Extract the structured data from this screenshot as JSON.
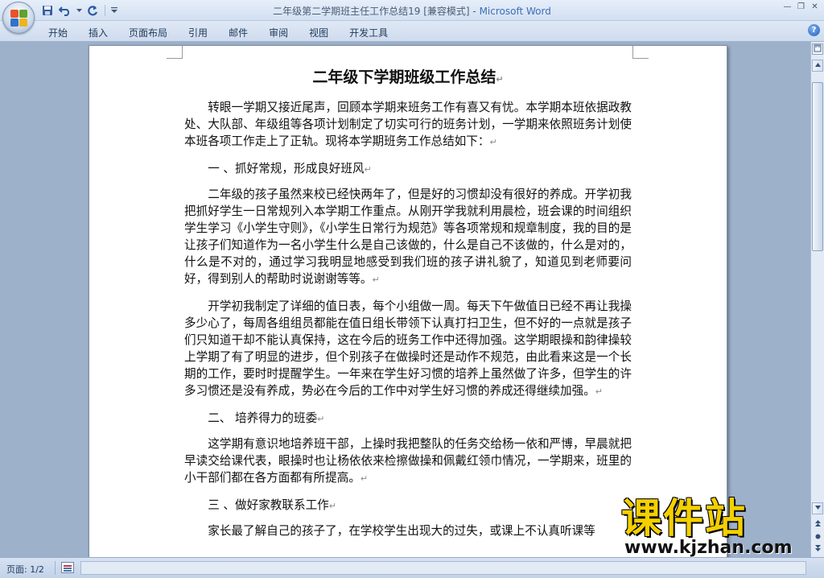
{
  "window": {
    "title": "二年级第二学期班主任工作总结19 [兼容模式]",
    "title_separator": " - ",
    "app_name": "Microsoft Word",
    "minimize": "—",
    "restore": "❐",
    "close": "✕"
  },
  "quick_access": {
    "save_icon": "save-icon",
    "undo_icon": "undo-icon",
    "redo_icon": "redo-icon",
    "customize_icon": "chevron-down-icon"
  },
  "ribbon": {
    "tabs": [
      "开始",
      "插入",
      "页面布局",
      "引用",
      "邮件",
      "审阅",
      "视图",
      "开发工具"
    ],
    "help": "?"
  },
  "document": {
    "title": "二年级下学期班级工作总结",
    "paragraphs": [
      "转眼一学期又接近尾声，回顾本学期来班务工作有喜又有忧。本学期本班依据政教处、大队部、年级组等各项计划制定了切实可行的班务计划，一学期来依照班务计划使本班各项工作走上了正轨。现将本学期班务工作总结如下：",
      "一 、抓好常规，形成良好班风",
      "二年级的孩子虽然来校已经快两年了，但是好的习惯却没有很好的养成。开学初我把抓好学生一日常规列入本学期工作重点。从刚开学我就利用晨检，班会课的时间组织学生学习《小学生守则》，《小学生日常行为规范》等各项常规和规章制度，我的目的是让孩子们知道作为一名小学生什么是自己该做的，什么是自己不该做的，什么是对的，什么是不对的，通过学习我明显地感受到我们班的孩子讲礼貌了，知道见到老师要问好，得到别人的帮助时说谢谢等等。",
      "开学初我制定了详细的值日表，每个小组做一周。每天下午做值日已经不再让我操多少心了，每周各组组员都能在值日组长带领下认真打扫卫生，但不好的一点就是孩子们只知道干却不能认真保持，这在今后的班务工作中还得加强。这学期眼操和韵律操较上学期了有了明显的进步，但个别孩子在做操时还是动作不规范，由此看来这是一个长期的工作，要时时提醒学生。一年来在学生好习惯的培养上虽然做了许多，但学生的许多习惯还是没有养成，势必在今后的工作中对学生好习惯的养成还得继续加强。",
      "二、 培养得力的班委",
      "这学期有意识地培养班干部，上操时我把整队的任务交给杨一依和严博，早晨就把早读交给课代表，眼操时也让杨依依来检擦做操和佩戴红领巾情况，一学期来，班里的小干部们都在各方面都有所提高。",
      "三 、做好家教联系工作",
      "家长最了解自己的孩子了，在学校学生出现大的过失，或课上不认真听课等"
    ],
    "paragraph_mark": "↵"
  },
  "status": {
    "page_label": "页面: 1/2"
  },
  "watermark": {
    "main": "课件站",
    "url": "www.kjzhan.com"
  }
}
